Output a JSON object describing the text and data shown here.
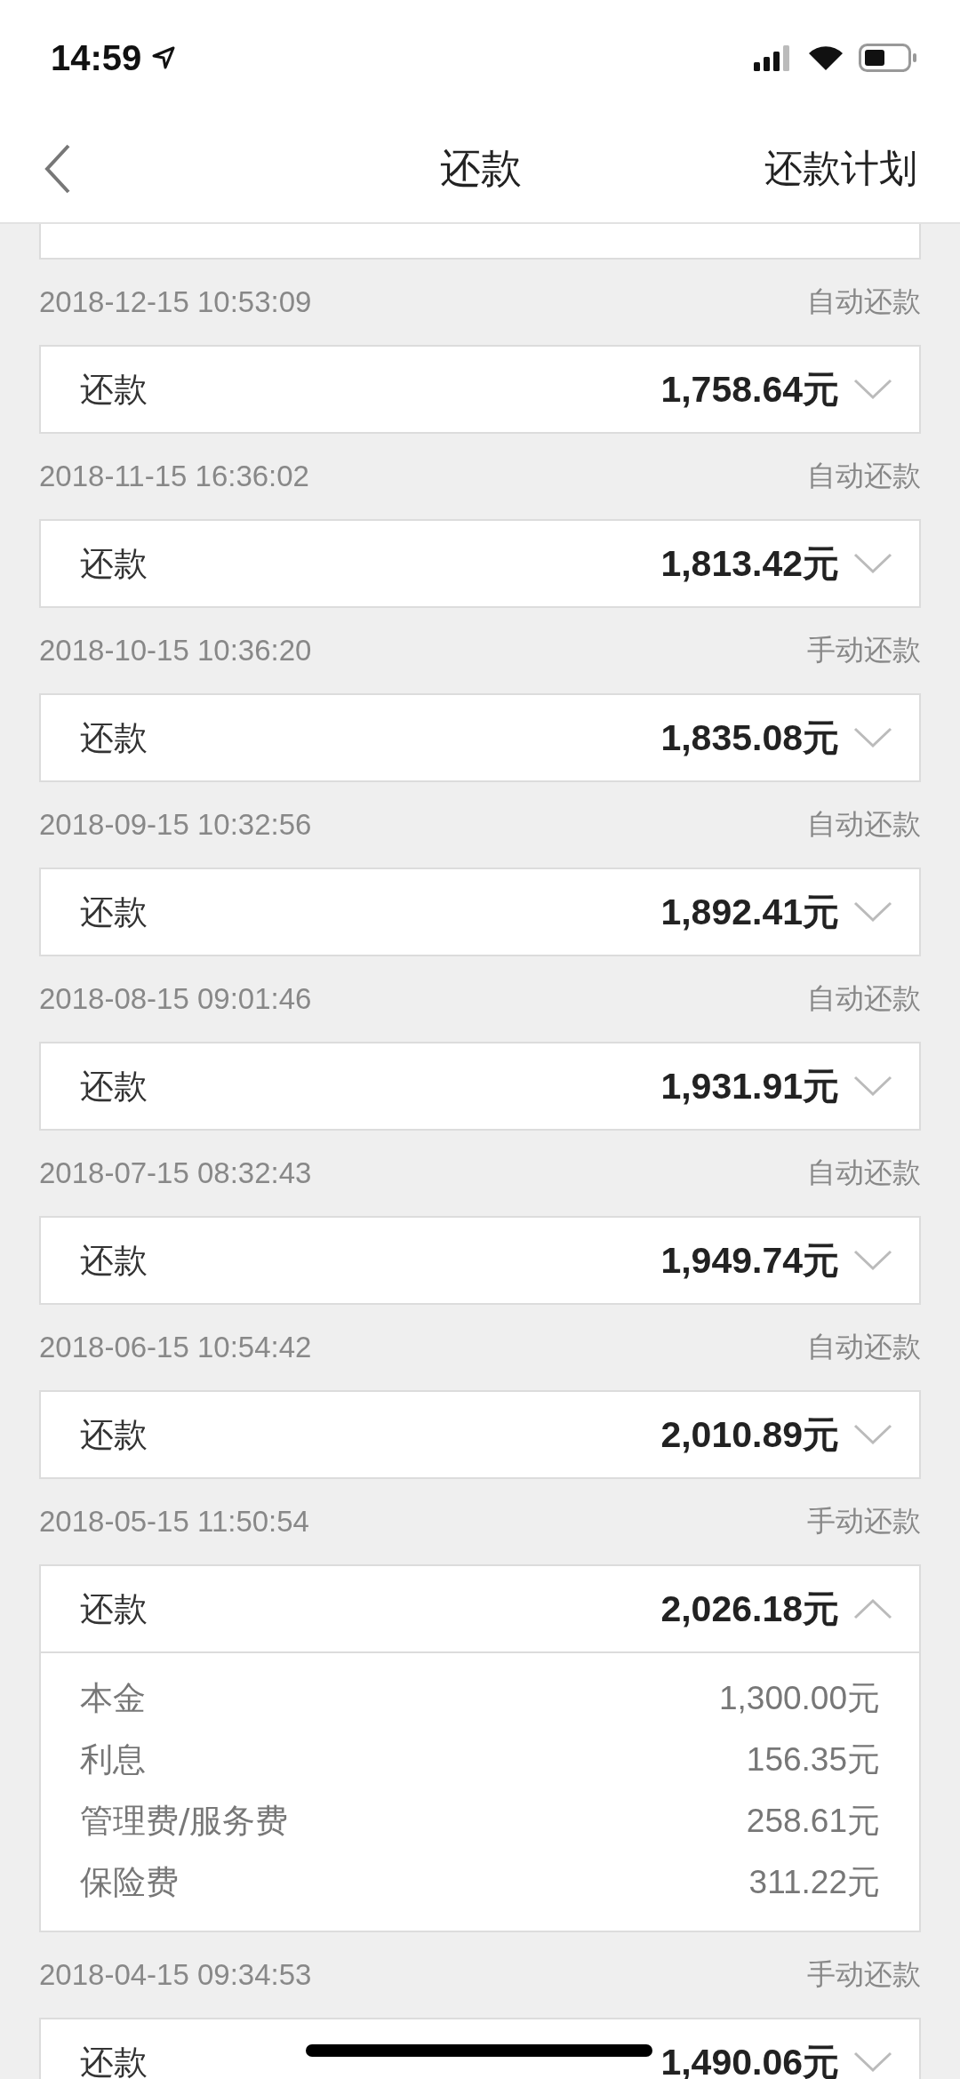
{
  "status_bar": {
    "time": "14:59"
  },
  "header": {
    "title": "还款",
    "action": "还款计划"
  },
  "records": [
    {
      "date": "2018-12-15 10:53:09",
      "type": "自动还款",
      "label": "还款",
      "amount": "1,758.64元",
      "expanded": false
    },
    {
      "date": "2018-11-15 16:36:02",
      "type": "自动还款",
      "label": "还款",
      "amount": "1,813.42元",
      "expanded": false
    },
    {
      "date": "2018-10-15 10:36:20",
      "type": "手动还款",
      "label": "还款",
      "amount": "1,835.08元",
      "expanded": false
    },
    {
      "date": "2018-09-15 10:32:56",
      "type": "自动还款",
      "label": "还款",
      "amount": "1,892.41元",
      "expanded": false
    },
    {
      "date": "2018-08-15 09:01:46",
      "type": "自动还款",
      "label": "还款",
      "amount": "1,931.91元",
      "expanded": false
    },
    {
      "date": "2018-07-15 08:32:43",
      "type": "自动还款",
      "label": "还款",
      "amount": "1,949.74元",
      "expanded": false
    },
    {
      "date": "2018-06-15 10:54:42",
      "type": "自动还款",
      "label": "还款",
      "amount": "2,010.89元",
      "expanded": false
    },
    {
      "date": "2018-05-15 11:50:54",
      "type": "手动还款",
      "label": "还款",
      "amount": "2,026.18元",
      "expanded": true,
      "details": [
        {
          "label": "本金",
          "value": "1,300.00元"
        },
        {
          "label": "利息",
          "value": "156.35元"
        },
        {
          "label": "管理费/服务费",
          "value": "258.61元"
        },
        {
          "label": "保险费",
          "value": "311.22元"
        }
      ]
    },
    {
      "date": "2018-04-15 09:34:53",
      "type": "手动还款",
      "label": "还款",
      "amount": "1,490.06元",
      "expanded": false
    }
  ]
}
